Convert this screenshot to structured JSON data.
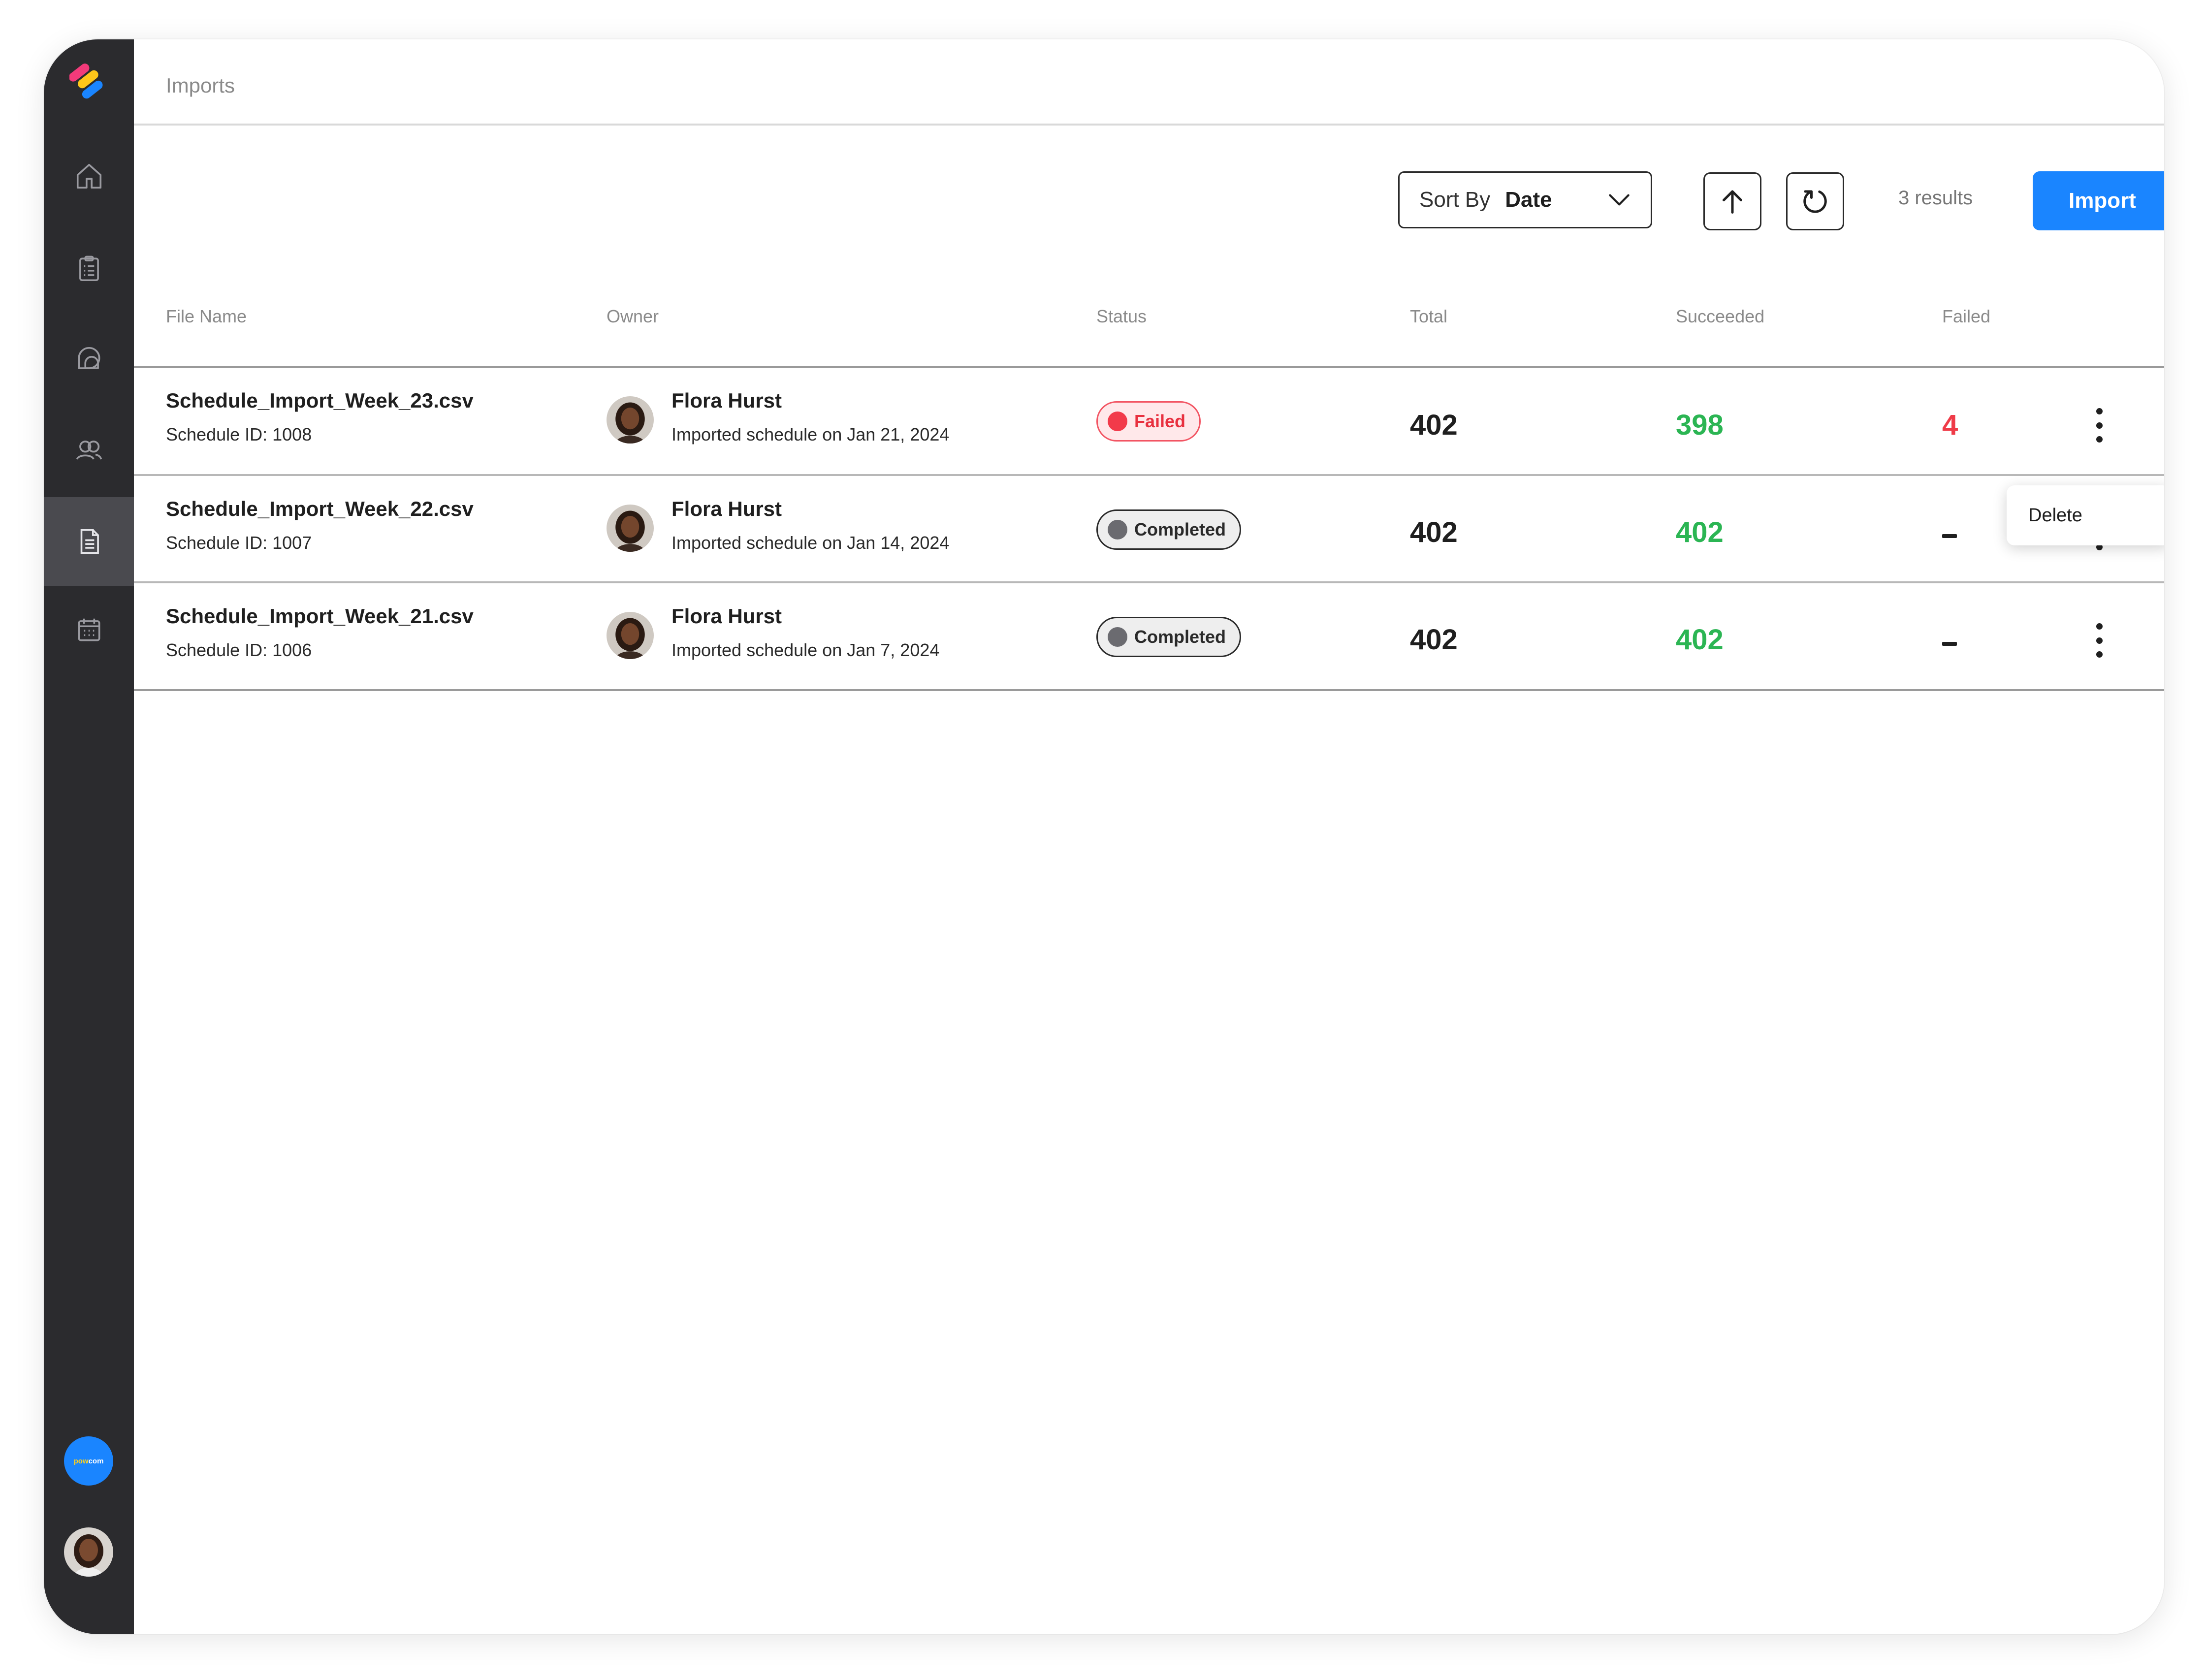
{
  "colors": {
    "sidebar_bg": "#2b2b2e",
    "accent": "#1a85ff",
    "success": "#2bb553",
    "danger": "#ef3b48"
  },
  "sidebar": {
    "items": [
      {
        "icon": "home-icon",
        "active": false
      },
      {
        "icon": "clipboard-icon",
        "active": false
      },
      {
        "icon": "chat-bubbles-icon",
        "active": false
      },
      {
        "icon": "users-icon",
        "active": false
      },
      {
        "icon": "document-icon",
        "active": true
      },
      {
        "icon": "calendar-icon",
        "active": false
      }
    ],
    "brand_badge": {
      "part1": "pow",
      "part2": "com"
    }
  },
  "header": {
    "breadcrumb": "Imports"
  },
  "toolbar": {
    "sort_label": "Sort By",
    "sort_value": "Date",
    "results": "3 results",
    "import_label": "Import"
  },
  "table": {
    "headers": {
      "file_name": "File Name",
      "owner": "Owner",
      "status": "Status",
      "total": "Total",
      "succeeded": "Succeeded",
      "failed": "Failed"
    },
    "rows": [
      {
        "file_name": "Schedule_Import_Week_23.csv",
        "schedule_id": "Schedule ID: 1008",
        "owner_name": "Flora Hurst",
        "owner_desc": "Imported schedule on Jan 21, 2024",
        "status": "Failed",
        "total": "402",
        "succeeded": "398",
        "failed": "4"
      },
      {
        "file_name": "Schedule_Import_Week_22.csv",
        "schedule_id": "Schedule ID: 1007",
        "owner_name": "Flora Hurst",
        "owner_desc": "Imported schedule on Jan 14, 2024",
        "status": "Completed",
        "total": "402",
        "succeeded": "402",
        "failed": ""
      },
      {
        "file_name": "Schedule_Import_Week_21.csv",
        "schedule_id": "Schedule ID: 1006",
        "owner_name": "Flora Hurst",
        "owner_desc": "Imported schedule on Jan 7, 2024",
        "status": "Completed",
        "total": "402",
        "succeeded": "402",
        "failed": ""
      }
    ]
  },
  "row_menu": {
    "delete_label": "Delete"
  }
}
